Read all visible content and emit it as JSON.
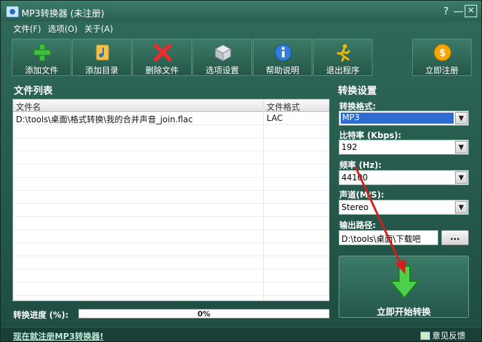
{
  "window": {
    "title": "MP3转换器 (未注册)",
    "controls": [
      "?",
      "—",
      "✕"
    ]
  },
  "menu": [
    "文件(F)",
    "选项(O)",
    "关于(A)"
  ],
  "toolbar": {
    "buttons": [
      {
        "label": "添加文件",
        "icon": "plus-icon"
      },
      {
        "label": "添加目录",
        "icon": "folder-music-icon"
      },
      {
        "label": "删除文件",
        "icon": "delete-x-icon"
      },
      {
        "label": "选项设置",
        "icon": "cube-settings-icon"
      },
      {
        "label": "帮助说明",
        "icon": "info-icon"
      },
      {
        "label": "退出程序",
        "icon": "running-person-icon"
      },
      {
        "label": "立即注册",
        "icon": "dollar-coin-icon"
      }
    ]
  },
  "file_list": {
    "title": "文件列表",
    "columns": [
      "文件名",
      "文件格式"
    ],
    "rows": [
      {
        "name": "D:\\tools\\桌面\\格式转换\\我的合并声音_join.flac",
        "format": "LAC"
      }
    ]
  },
  "progress": {
    "label": "转换进度 (%):",
    "value_text": "0%",
    "value": 0
  },
  "settings": {
    "title": "转换设置",
    "format_label": "转换格式:",
    "format_value": "MP3",
    "bitrate_label": "比特率 (Kbps):",
    "bitrate_value": "192",
    "frequency_label": "频率 (Hz):",
    "frequency_value": "44100",
    "channel_label": "声道(M/S):",
    "channel_value": "Stereo",
    "output_label": "输出路径:",
    "output_value": "D:\\tools\\桌面\\下载吧",
    "browse_label": "...",
    "convert_label": "立即开始转换"
  },
  "status": {
    "register_link": "现在就注册MP3转换器!",
    "feedback": "意见反馈"
  },
  "colors": {
    "window_bg": "#2a5f50",
    "accent_red": "#d21e1e",
    "select_highlight": "#2e6cd2"
  }
}
